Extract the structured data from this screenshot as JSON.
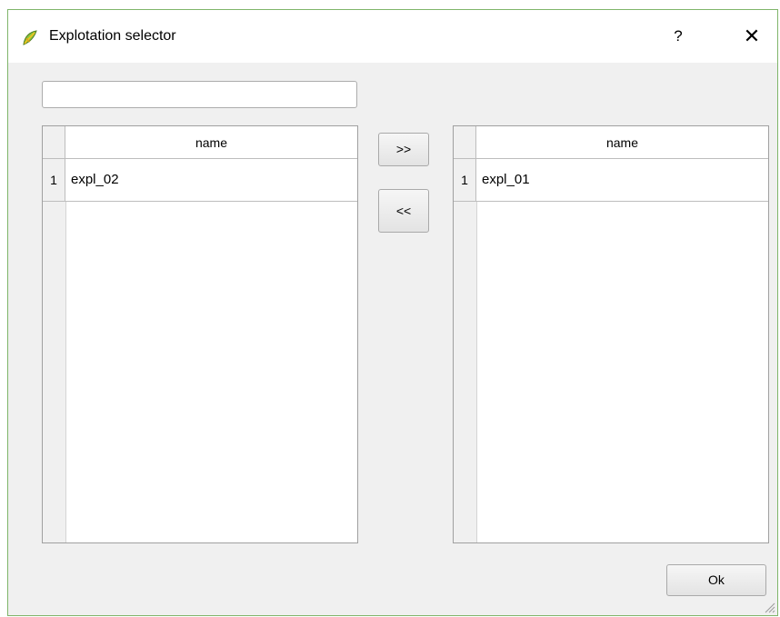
{
  "window": {
    "title": "Explotation selector",
    "help_label": "?",
    "close_label": "✕"
  },
  "search": {
    "value": "",
    "placeholder": ""
  },
  "left_table": {
    "column": "name",
    "rows": [
      {
        "num": "1",
        "name": "expl_02"
      }
    ]
  },
  "right_table": {
    "column": "name",
    "rows": [
      {
        "num": "1",
        "name": "expl_01"
      }
    ]
  },
  "buttons": {
    "add": ">>",
    "remove": "<<",
    "ok": "Ok"
  },
  "icons": {
    "app": "qgis-leaf-icon",
    "help": "help-icon",
    "close": "close-icon",
    "grip": "resize-grip-icon"
  },
  "colors": {
    "window_border": "#7fb56a",
    "dialog_bg": "#f0f0f0"
  }
}
